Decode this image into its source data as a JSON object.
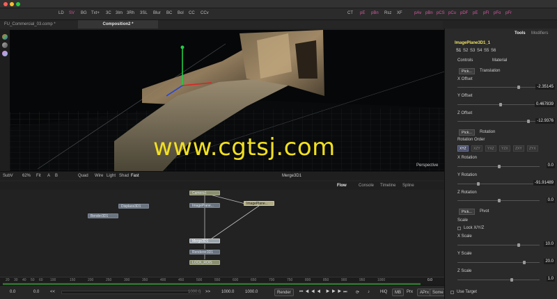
{
  "window": {
    "title": ""
  },
  "toolbar": {
    "items": [
      "LD",
      "SV",
      "BG",
      "Txt+",
      "3C",
      "3Im",
      "3Rh",
      "3SL",
      "Blur",
      "BC",
      "Bol",
      "CC",
      "CCv",
      "CT",
      "pE",
      "pBn",
      "Rsz",
      "XF",
      "pAv",
      "pBn",
      "pCS",
      "pCu",
      "pDF",
      "pE",
      "pFl",
      "pFo",
      "pFr"
    ]
  },
  "tabs": [
    {
      "label": "FU_Commercial_03.comp *"
    },
    {
      "label": "Composition2 *"
    }
  ],
  "viewer": {
    "watermark": "www.cgtsj.com",
    "perspective_label": "Perspective",
    "bar": {
      "subv": "SubV",
      "zoom": "62%",
      "fit": "Fit",
      "a_label": "A",
      "b_label": "B",
      "quad": "Quad",
      "wire": "Wire",
      "light": "Light",
      "shad": "Shad",
      "fast": "Fast",
      "view_name": "Merge3D1"
    }
  },
  "flow": {
    "tabs": [
      "Flow",
      "Console",
      "Timeline",
      "Spline"
    ],
    "nodes": {
      "camera": "Camera1",
      "imageplane_a": "ImagePlane...",
      "imageplane_b": "ImagePlane...",
      "displace": "Displace3D1",
      "bender": "Bender3D1",
      "merge": "Merge3D1",
      "renderer": "Renderer3D1",
      "lock": "LOCK_ROIS"
    }
  },
  "timeline": {
    "ticks": [
      "20",
      "30",
      "40",
      "50",
      "60",
      "100",
      "150",
      "200",
      "250",
      "300",
      "350",
      "400",
      "450",
      "500",
      "550",
      "600",
      "650",
      "700",
      "750",
      "800",
      "850",
      "900",
      "950",
      "1000"
    ],
    "end_value": "0.0"
  },
  "transport": {
    "start": "0.0",
    "current": "0.0",
    "nav_prev": "<<",
    "nav_next": ">>",
    "field_a": "1000.0",
    "field_b": "1000.0",
    "field_c": "1000.0",
    "render": "Render",
    "hiq": "HiQ",
    "mb": "MB",
    "prx": "Prx",
    "aprx": "APrx",
    "some": "Some"
  },
  "panel": {
    "tabs": [
      "Tools",
      "Modifiers"
    ],
    "node_name": "ImagePlane3D1_1",
    "stereo_tabs": [
      "S1",
      "S2",
      "S3",
      "S4",
      "S5",
      "S6"
    ],
    "subtabs": [
      "Controls",
      "Material"
    ],
    "translation": {
      "pick": "Pick...",
      "title": "Translation",
      "x_label": "X Offset",
      "x_value": "-2.35145",
      "y_label": "Y Offset",
      "y_value": "0.467839",
      "z_label": "Z Offset",
      "z_value": "-12.9376"
    },
    "rotation": {
      "pick": "Pick...",
      "title": "Rotation",
      "order_label": "Rotation Order",
      "orders": [
        "XYZ",
        "XZY",
        "YXZ",
        "YZX",
        "ZXY",
        "ZYX"
      ],
      "x_label": "X Rotation",
      "x_value": "0.0",
      "y_label": "Y Rotation",
      "y_value": "-91.91489",
      "z_label": "Z Rotation",
      "z_value": "0.0"
    },
    "pivot": {
      "pick": "Pick...",
      "title": "Pivot"
    },
    "scale": {
      "title": "Scale",
      "lock_label": "Lock X/Y/Z",
      "x_label": "X Scale",
      "x_value": "10.0",
      "y_label": "Y Scale",
      "y_value": "20.0",
      "z_label": "Z Scale",
      "z_value": "1.0"
    },
    "use_target": "Use Target"
  },
  "colors": {
    "accent": "#d55aa0",
    "watermark": "#f2e01e",
    "flow_bg": "#222222"
  }
}
